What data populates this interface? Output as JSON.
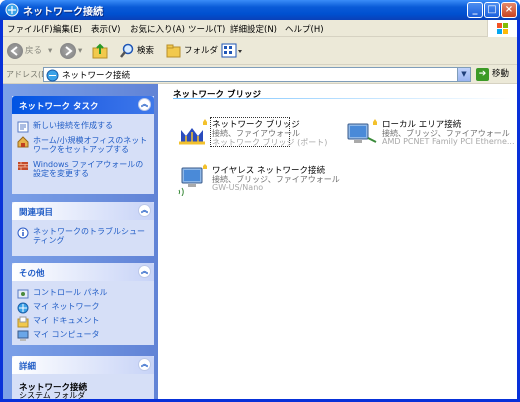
{
  "window": {
    "title": "ネットワーク接続"
  },
  "menu": [
    "ファイル(F)",
    "編集(E)",
    "表示(V)",
    "お気に入り(A)",
    "ツール(T)",
    "詳細設定(N)",
    "ヘルプ(H)"
  ],
  "toolbar": {
    "back": "戻る",
    "search": "検索",
    "folders": "フォルダ"
  },
  "address": {
    "label": "アドレス(D)",
    "value": "ネットワーク接続",
    "go": "移動"
  },
  "sidebar": {
    "tasks": {
      "title": "ネットワーク タスク",
      "items": [
        "新しい接続を作成する",
        "ホーム/小規模オフィスのネットワークをセットアップする",
        "Windows ファイアウォールの設定を変更する"
      ]
    },
    "related": {
      "title": "関連項目",
      "items": [
        "ネットワークのトラブルシューティング"
      ]
    },
    "other": {
      "title": "その他",
      "items": [
        "コントロール パネル",
        "マイ ネットワーク",
        "マイ ドキュメント",
        "マイ コンピュータ"
      ]
    },
    "details": {
      "title": "詳細",
      "name": "ネットワーク接続",
      "type": "システム フォルダ"
    }
  },
  "content": {
    "group": "ネットワーク ブリッジ",
    "connections": [
      {
        "name": "ネットワーク ブリッジ",
        "status": "接続、ファイアウォール",
        "device": "ネットワーク ブリッジ (ポート)"
      },
      {
        "name": "ローカル エリア接続",
        "status": "接続、ブリッジ、ファイアウォール",
        "device": "AMD PCNET Family PCI Etherne..."
      },
      {
        "name": "ワイヤレス ネットワーク接続",
        "status": "接続、ブリッジ、ファイアウォール",
        "device": "GW-US/Nano"
      }
    ]
  },
  "colors": {
    "accent": "#0054e3",
    "link": "#215dc6",
    "sidebar": "#6f91de"
  }
}
